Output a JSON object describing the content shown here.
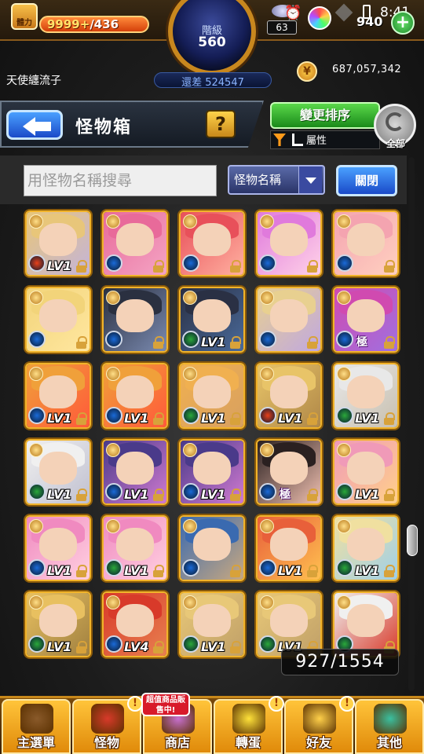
{
  "status": {
    "stamina_icon_label": "體力",
    "stamina_current": "9999+",
    "stamina_max": "/436",
    "level_label": "階級",
    "level_value": "560",
    "gem_count": "63",
    "clock": "8:41",
    "orb_count": "940"
  },
  "player": {
    "name": "天使纏流子",
    "exp_remaining": "還差 524547",
    "coins": "687,057,342"
  },
  "header": {
    "title": "怪物箱",
    "help_label": "?",
    "sort_label": "變更排序",
    "filter_attr_label": "屬性",
    "refresh_label": "全部"
  },
  "search": {
    "placeholder": "用怪物名稱搜尋",
    "select_value": "怪物名稱",
    "close_label": "關閉"
  },
  "box_counter": "927/1554",
  "monsters": [
    {
      "level": "LV1",
      "element": "fire",
      "colors": [
        "#e8c67a",
        "#c4b4d8"
      ]
    },
    {
      "level": "",
      "element": "water",
      "colors": [
        "#e86a9a",
        "#f4a4c4"
      ]
    },
    {
      "level": "",
      "element": "water",
      "colors": [
        "#e8505a",
        "#ffb0a0"
      ]
    },
    {
      "level": "",
      "element": "water",
      "colors": [
        "#e07adc",
        "#ffd2e8"
      ]
    },
    {
      "level": "",
      "element": "water",
      "colors": [
        "#f4a4b0",
        "#ffd0c0"
      ]
    },
    {
      "level": "",
      "element": "water",
      "colors": [
        "#f2d47a",
        "#ffe7a0"
      ]
    },
    {
      "level": "",
      "element": "water",
      "colors": [
        "#2a3040",
        "#7a8ab0"
      ]
    },
    {
      "level": "LV1",
      "element": "wood",
      "colors": [
        "#2a3044",
        "#4a6a9a"
      ]
    },
    {
      "level": "",
      "element": "water",
      "colors": [
        "#e8d090",
        "#c0a8e0"
      ]
    },
    {
      "level": "",
      "element": "water",
      "tag": "極",
      "colors": [
        "#d04ab0",
        "#a070e0"
      ]
    },
    {
      "level": "LV1",
      "element": "water",
      "colors": [
        "#f0a03a",
        "#ff5a3a"
      ]
    },
    {
      "level": "LV1",
      "element": "water",
      "colors": [
        "#f0a03a",
        "#ff5a3a"
      ]
    },
    {
      "level": "LV1",
      "element": "wood",
      "colors": [
        "#f0b050",
        "#d8a060"
      ]
    },
    {
      "level": "LV1",
      "element": "fire",
      "colors": [
        "#e8c468",
        "#b08848"
      ]
    },
    {
      "level": "LV1",
      "element": "wood",
      "colors": [
        "#e8e8e8",
        "#c8c0b0"
      ]
    },
    {
      "level": "LV1",
      "element": "wood",
      "colors": [
        "#f0f0f0",
        "#c0c0d0"
      ]
    },
    {
      "level": "LV1",
      "element": "water",
      "colors": [
        "#4a3a8a",
        "#d07ad0"
      ]
    },
    {
      "level": "LV1",
      "element": "water",
      "colors": [
        "#4a3a8a",
        "#d07ad0"
      ]
    },
    {
      "level": "",
      "element": "water",
      "tag": "極",
      "colors": [
        "#2a2020",
        "#f0c0b0"
      ]
    },
    {
      "level": "LV1",
      "element": "wood",
      "colors": [
        "#f09ab8",
        "#ffd08a"
      ]
    },
    {
      "level": "LV1",
      "element": "water",
      "colors": [
        "#f08ac0",
        "#ffd0e0"
      ]
    },
    {
      "level": "LV1",
      "element": "wood",
      "colors": [
        "#f08ac0",
        "#ffd0e0"
      ]
    },
    {
      "level": "",
      "element": "water",
      "colors": [
        "#3a6ab0",
        "#c8a880"
      ]
    },
    {
      "level": "LV1",
      "element": "water",
      "colors": [
        "#e8603a",
        "#ffc050"
      ]
    },
    {
      "level": "LV1",
      "element": "wood",
      "colors": [
        "#f0e0a0",
        "#a0d0e8"
      ]
    },
    {
      "level": "LV1",
      "element": "wood",
      "colors": [
        "#e8c060",
        "#a08040"
      ]
    },
    {
      "level": "LV4",
      "element": "water",
      "colors": [
        "#d83a2a",
        "#e88050"
      ]
    },
    {
      "level": "LV1",
      "element": "wood",
      "colors": [
        "#e8c878",
        "#c0a068"
      ]
    },
    {
      "level": "LV1",
      "element": "wood",
      "colors": [
        "#e8c878",
        "#c0a068"
      ]
    },
    {
      "level": "",
      "element": "wood",
      "colors": [
        "#f0f0f0",
        "#d83a2a"
      ]
    }
  ],
  "nav": [
    {
      "label": "主選單",
      "color": "#8a5a2a"
    },
    {
      "label": "怪物",
      "color": "#d83a2a",
      "badge": "!"
    },
    {
      "label": "商店",
      "color": "#c870d0"
    },
    {
      "label": "轉蛋",
      "color": "#ffe23a",
      "badge": "!"
    },
    {
      "label": "好友",
      "color": "#ffd04a",
      "badge": "!"
    },
    {
      "label": "其他",
      "color": "#3ac0a0"
    }
  ],
  "sale_badge": "超值商品販售中!"
}
